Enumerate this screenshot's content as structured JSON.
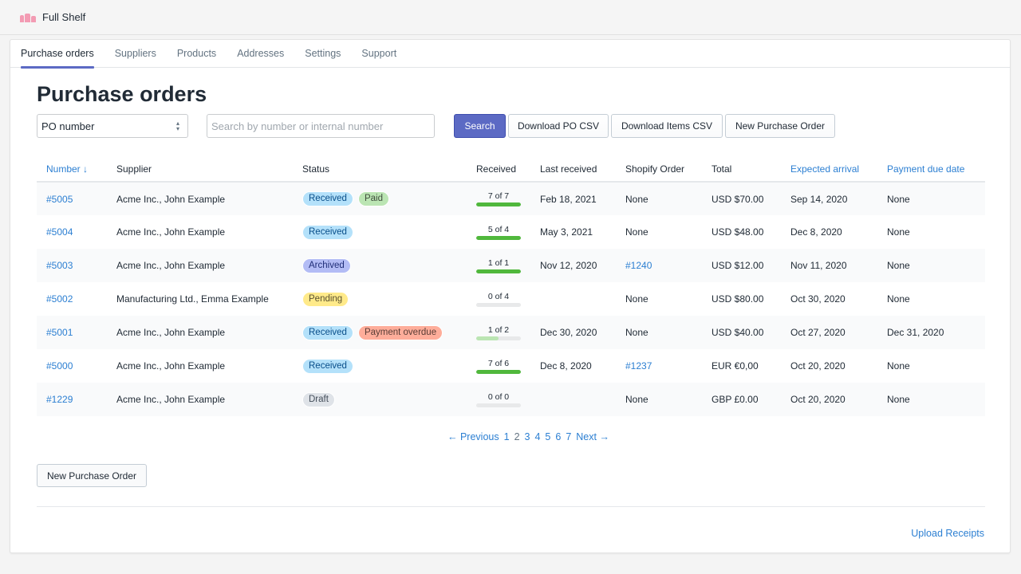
{
  "app": {
    "title": "Full Shelf",
    "logo_icon": "shelf-logo-icon"
  },
  "tabs": [
    {
      "label": "Purchase orders",
      "active": true
    },
    {
      "label": "Suppliers",
      "active": false
    },
    {
      "label": "Products",
      "active": false
    },
    {
      "label": "Addresses",
      "active": false
    },
    {
      "label": "Settings",
      "active": false
    },
    {
      "label": "Support",
      "active": false
    }
  ],
  "page": {
    "title": "Purchase orders"
  },
  "filters": {
    "field_select": {
      "value": "PO number"
    },
    "search": {
      "placeholder": "Search by number or internal number",
      "value": ""
    },
    "search_button": "Search",
    "download_po_csv": "Download PO CSV",
    "download_items_csv": "Download Items CSV",
    "new_po_button": "New Purchase Order"
  },
  "colors": {
    "accent": "#5c6ac4",
    "link": "#2c7fd2",
    "progress_full": "#50b83c",
    "progress_partial": "#bbe5b3",
    "progress_track": "#e8e9ea"
  },
  "table": {
    "columns": [
      {
        "label": "Number ↓",
        "sortable": true
      },
      {
        "label": "Supplier",
        "sortable": false
      },
      {
        "label": "Status",
        "sortable": false
      },
      {
        "label": "Received",
        "sortable": false
      },
      {
        "label": "Last received",
        "sortable": false
      },
      {
        "label": "Shopify Order",
        "sortable": false
      },
      {
        "label": "Total",
        "sortable": false
      },
      {
        "label": "Expected arrival",
        "sortable": true
      },
      {
        "label": "Payment due date",
        "sortable": true
      }
    ],
    "rows": [
      {
        "number": "#5005",
        "supplier": "Acme Inc., John Example",
        "badges": [
          {
            "label": "Received",
            "type": "received"
          },
          {
            "label": "Paid",
            "type": "paid"
          }
        ],
        "received_text": "7 of 7",
        "received_fraction": 1.0,
        "last_received": "Feb 18, 2021",
        "shopify_order": "None",
        "shopify_link": false,
        "total": "USD $70.00",
        "expected_arrival": "Sep 14, 2020",
        "payment_due": "None"
      },
      {
        "number": "#5004",
        "supplier": "Acme Inc., John Example",
        "badges": [
          {
            "label": "Received",
            "type": "received"
          }
        ],
        "received_text": "5 of 4",
        "received_fraction": 1.0,
        "last_received": "May 3, 2021",
        "shopify_order": "None",
        "shopify_link": false,
        "total": "USD $48.00",
        "expected_arrival": "Dec 8, 2020",
        "payment_due": "None"
      },
      {
        "number": "#5003",
        "supplier": "Acme Inc., John Example",
        "badges": [
          {
            "label": "Archived",
            "type": "archived"
          }
        ],
        "received_text": "1 of 1",
        "received_fraction": 1.0,
        "last_received": "Nov 12, 2020",
        "shopify_order": "#1240",
        "shopify_link": true,
        "total": "USD $12.00",
        "expected_arrival": "Nov 11, 2020",
        "payment_due": "None"
      },
      {
        "number": "#5002",
        "supplier": "Manufacturing Ltd., Emma Example",
        "badges": [
          {
            "label": "Pending",
            "type": "pending"
          }
        ],
        "received_text": "0 of 4",
        "received_fraction": 0.0,
        "last_received": "",
        "shopify_order": "None",
        "shopify_link": false,
        "total": "USD $80.00",
        "expected_arrival": "Oct 30, 2020",
        "payment_due": "None"
      },
      {
        "number": "#5001",
        "supplier": "Acme Inc., John Example",
        "badges": [
          {
            "label": "Received",
            "type": "received"
          },
          {
            "label": "Payment overdue",
            "type": "overdue"
          }
        ],
        "received_text": "1 of 2",
        "received_fraction": 0.5,
        "last_received": "Dec 30, 2020",
        "shopify_order": "None",
        "shopify_link": false,
        "total": "USD $40.00",
        "expected_arrival": "Oct 27, 2020",
        "payment_due": "Dec 31, 2020"
      },
      {
        "number": "#5000",
        "supplier": "Acme Inc., John Example",
        "badges": [
          {
            "label": "Received",
            "type": "received"
          }
        ],
        "received_text": "7 of 6",
        "received_fraction": 1.0,
        "last_received": "Dec 8, 2020",
        "shopify_order": "#1237",
        "shopify_link": true,
        "total": "EUR €0,00",
        "expected_arrival": "Oct 20, 2020",
        "payment_due": "None"
      },
      {
        "number": "#1229",
        "supplier": "Acme Inc., John Example",
        "badges": [
          {
            "label": "Draft",
            "type": "draft"
          }
        ],
        "received_text": "0 of 0",
        "received_fraction": 0.0,
        "last_received": "",
        "shopify_order": "None",
        "shopify_link": false,
        "total": "GBP £0.00",
        "expected_arrival": "Oct 20, 2020",
        "payment_due": "None"
      }
    ]
  },
  "pagination": {
    "previous": "← Previous",
    "next": "Next →",
    "pages": [
      "1",
      "2",
      "3",
      "4",
      "5",
      "6",
      "7"
    ],
    "current": "2"
  },
  "footer": {
    "new_po_button": "New Purchase Order",
    "upload_receipts": "Upload Receipts"
  }
}
